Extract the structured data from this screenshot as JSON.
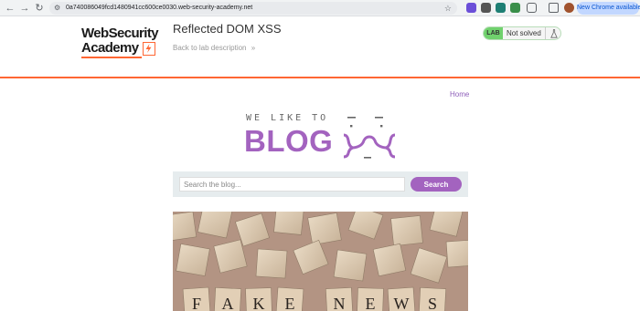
{
  "browser": {
    "url": "0a740086049fcd1480941cc600ce0030.web-security-academy.net",
    "update_label": "New Chrome available"
  },
  "lab": {
    "logo_line1": "WebSecurity",
    "logo_line2": "Academy",
    "title": "Reflected DOM XSS",
    "back_link": "Back to lab description",
    "back_chevron": "»",
    "status_tag": "LAB",
    "status_text": "Not solved"
  },
  "blog": {
    "home_link": "Home",
    "banner_tagline": "WE LIKE TO",
    "banner_title": "BLOG",
    "search": {
      "placeholder": "Search the blog...",
      "button_label": "Search"
    },
    "post_image_text": "FAKE NEWS"
  },
  "colors": {
    "accent": "#a363bf",
    "lab_orange": "#ff6633",
    "status_green": "#70d16d"
  }
}
